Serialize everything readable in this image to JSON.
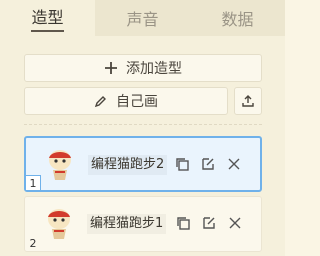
{
  "tabs": [
    {
      "label": "造型"
    },
    {
      "label": "声音"
    },
    {
      "label": "数据"
    }
  ],
  "actions": {
    "add_label": "添加造型",
    "paint_label": "自己画"
  },
  "costumes": [
    {
      "index": "1",
      "name": "编程猫跑步2"
    },
    {
      "index": "2",
      "name": "编程猫跑步1"
    }
  ]
}
